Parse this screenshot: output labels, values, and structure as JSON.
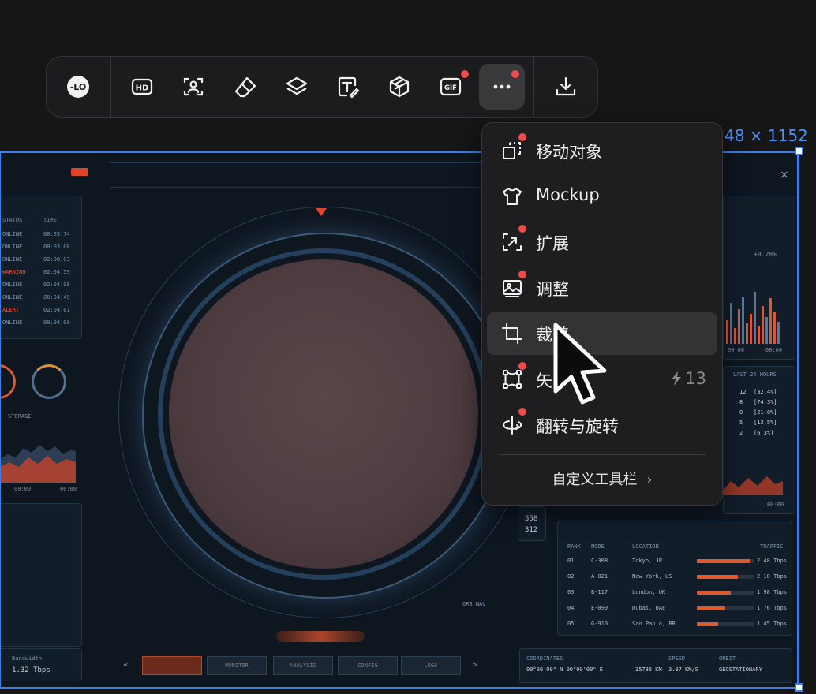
{
  "canvas": {
    "dimension_label": "48 × 1152",
    "close_glyph": "×",
    "left_panel": {
      "col_status": "STATUS",
      "col_time": "TIME",
      "rows": [
        {
          "status": "ONLINE",
          "time": "00:03:74",
          "alert": false
        },
        {
          "status": "ONLINE",
          "time": "00:03:08",
          "alert": false
        },
        {
          "status": "ONLINE",
          "time": "02:08:03",
          "alert": false
        },
        {
          "status": "WARNING",
          "time": "02:04:59",
          "alert": true
        },
        {
          "status": "ONLINE",
          "time": "02:04:08",
          "alert": false
        },
        {
          "status": "ONLINE",
          "time": "00:04:49",
          "alert": false
        },
        {
          "status": "ALERT",
          "time": "02:04:01",
          "alert": true
        },
        {
          "status": "ONLINE",
          "time": "00:04:00",
          "alert": false
        }
      ],
      "storage_label": "STORAGE",
      "axis_start": "00:00",
      "axis_end": "00:00",
      "bandwidth_label": "Bandwidth",
      "bandwidth_value": "1.32 Tbps"
    },
    "right_panel": {
      "delta": "+0.28%",
      "axis_start": "00:00",
      "axis_end": "00:00",
      "last24_title": "LAST 24 HOURS",
      "stats": [
        {
          "n": "12",
          "pct": "[32.4%]"
        },
        {
          "n": "8",
          "pct": "[74.3%]"
        },
        {
          "n": "8",
          "pct": "[21.6%]"
        },
        {
          "n": "5",
          "pct": "[13.5%]"
        },
        {
          "n": "2",
          "pct": "[6.3%]"
        }
      ],
      "mini_axis": "00:00",
      "badge_top": "558",
      "badge_bottom": "312"
    },
    "table": {
      "headers": [
        "RANK",
        "NODE",
        "LOCATION",
        "TRAFFIC"
      ],
      "rows": [
        {
          "rank": "01",
          "node": "C-308",
          "location": "Tokyo, JP",
          "traffic": "2.48 Tbps",
          "level": 0.95
        },
        {
          "rank": "02",
          "node": "A-021",
          "location": "New York, US",
          "traffic": "2.18 Tbps",
          "level": 0.72
        },
        {
          "rank": "03",
          "node": "B-117",
          "location": "London, UK",
          "traffic": "1.98 Tbps",
          "level": 0.6
        },
        {
          "rank": "04",
          "node": "E-099",
          "location": "Dubai, UAE",
          "traffic": "1.76 Tbps",
          "level": 0.5
        },
        {
          "rank": "05",
          "node": "G-910",
          "location": "Sao Paulo, BR",
          "traffic": "1.45 Tbps",
          "level": 0.38
        }
      ]
    },
    "bottom_nav": {
      "prev": "«",
      "next": "»",
      "tabs": [
        "",
        "MONITOR",
        "ANALYSIS",
        "CONFIG",
        "LOGS"
      ]
    },
    "coordinates": {
      "label": "COORDINATES",
      "value": "00°00'00\" N 00°00'00\" E",
      "altitude": "35786 KM",
      "speed_label": "SPEED",
      "speed_value": "3.07 KM/S",
      "orbit_label": "ORBIT",
      "orbit_value": "GEOSTATIONARY"
    },
    "side_tag": "ORB.NAV"
  },
  "toolbar": {
    "items": [
      {
        "name": "logo-icon",
        "label": "LO"
      },
      {
        "name": "hd-button",
        "label": "HD"
      },
      {
        "name": "portrait-select-button",
        "label": ""
      },
      {
        "name": "eraser-button",
        "label": ""
      },
      {
        "name": "layers-button",
        "label": ""
      },
      {
        "name": "text-edit-button",
        "label": ""
      },
      {
        "name": "3d-box-button",
        "label": ""
      },
      {
        "name": "gif-button",
        "label": "GIF"
      },
      {
        "name": "more-button",
        "label": "···"
      },
      {
        "name": "download-button",
        "label": ""
      }
    ]
  },
  "menu": {
    "items": [
      {
        "label": "移动对象",
        "icon": "move-object-icon",
        "new": true
      },
      {
        "label": "Mockup",
        "icon": "tshirt-icon",
        "new": false
      },
      {
        "label": "扩展",
        "icon": "expand-icon",
        "new": true
      },
      {
        "label": "调整",
        "icon": "adjust-image-icon",
        "new": true
      },
      {
        "label": "裁剪",
        "icon": "crop-icon",
        "new": false
      },
      {
        "label": "矢",
        "icon": "vector-icon",
        "new": true,
        "credit": "13"
      },
      {
        "label": "翻转与旋转",
        "icon": "flip-rotate-icon",
        "new": true
      }
    ],
    "customize_label": "自定义工具栏",
    "customize_chevron": "›"
  },
  "colors": {
    "accent": "#3a7ef0",
    "notify": "#f04a4a",
    "hud_orange": "#e05a2c"
  }
}
